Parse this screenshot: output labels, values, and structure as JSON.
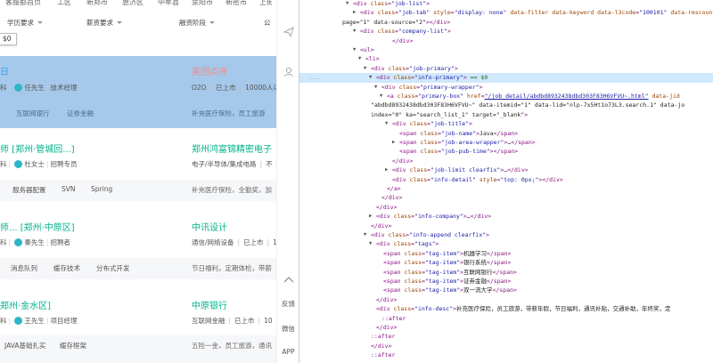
{
  "topnav": [
    "客服都首页",
    "工区",
    "新郑市",
    "惠济区",
    "中牟县",
    "荥阳市",
    "新密市",
    "上街区"
  ],
  "filters": {
    "education": "学历要求",
    "salary": "薪资要求",
    "funding": "融资阶段",
    "scale": "公"
  },
  "tooltip": "$0",
  "side_rail": {
    "feedback": "反馈",
    "wechat": "微信",
    "app": "APP"
  },
  "jobs": [
    {
      "title": "日",
      "company": "美团点评",
      "meta_left": "科",
      "recruiter": "任先生",
      "recruiter_role": "技术经理",
      "company_meta": [
        "O2O",
        "已上市",
        "10000人以"
      ],
      "tags": [
        "互联网银行",
        "证券金融"
      ],
      "benefit": "补充医疗保险，员工旅游"
    },
    {
      "title": "师  [郑州·管城回...]",
      "company": "郑州鸿富锦精密电子",
      "meta_left": "科",
      "recruiter": "杜女士",
      "recruiter_role": "招聘专员",
      "company_meta": [
        "电子/半导体/集成电路",
        "不"
      ],
      "tags": [
        "服务器配置",
        "SVN",
        "Spring"
      ],
      "benefit": "补充医疗保险，全勤奖，加"
    },
    {
      "title": "师...  [郑州·中原区]",
      "company": "中讯设计",
      "meta_left": "科",
      "recruiter": "秦先生",
      "recruiter_role": "招聘者",
      "company_meta": [
        "通信/网络设备",
        "已上市",
        "1"
      ],
      "tags": [
        "消息队列",
        "缓存技术",
        "分布式开发"
      ],
      "benefit": "节日福利，定期体检，带薪"
    },
    {
      "title": "郑州·金水区]",
      "company": "中原银行",
      "meta_left": "科",
      "recruiter": "王先生",
      "recruiter_role": "项目经理",
      "company_meta": [
        "互联网金融",
        "已上市",
        "10"
      ],
      "tags": [
        "JAVA基础扎实",
        "缓存框架"
      ],
      "benefit": "五险一金，员工旅游，通讯"
    }
  ],
  "devtools": {
    "selected_suffix": "== $0",
    "lines": [
      "<div class=\"job-list\">",
      "<div class=\"job-tab\" style=\"display: none\" data-filter data-keyword data-l3code=\"100101\" data-rescount=\"300\"",
      "page=\"1\" data-source=\"2\"></div>",
      "<div class=\"company-list\">",
      "</div>",
      "<ul>",
      "<li>",
      "<div class=\"job-primary\">",
      "<div class=\"info-primary\">",
      "<div class=\"primary-wrapper\">",
      "<a class=\"primary-box\" href=\"/job_detail/abdbd8932438dbd303F83H6VFVU~.html\" data-jid=",
      "\"abdbd8932438dbd303F83H6VFVU~\" data-itemid=\"1\" data-lid=\"nlp-7x5Ht1o73L3.search.1\" data-jo",
      "index=\"0\" ka=\"search_list_1\" target=\"_blank\">",
      "<div class=\"job-title\">",
      "<span class=\"job-name\">Java</span>",
      "<span class=\"job-area-wrapper\">…</span>",
      "<span class=\"job-pub-time\"></span>",
      "</div>",
      "<div class=\"job-limit clearfix\">…</div>",
      "<div class=\"info-detail\" style=\"top: 0px;\"></div>",
      "</a>",
      "</div>",
      "</div>",
      "<div class=\"info-company\">…</div>",
      "</div>",
      "<div class=\"info-append clearfix\">",
      "<div class=\"tags\">",
      "<span class=\"tag-item\">机器学习</span>",
      "<span class=\"tag-item\">银行系统</span>",
      "<span class=\"tag-item\">互联网银行</span>",
      "<span class=\"tag-item\">证券金融</span>",
      "<span class=\"tag-item\">双一流大学</span>",
      "</div>",
      "<div class=\"info-desc\">补充医疗保险，员工旅游，带薪年假，节日福利，通讯补贴，交通补助，年终奖，定",
      "::after",
      "</div>",
      "::after",
      "</div>",
      "::after"
    ]
  }
}
